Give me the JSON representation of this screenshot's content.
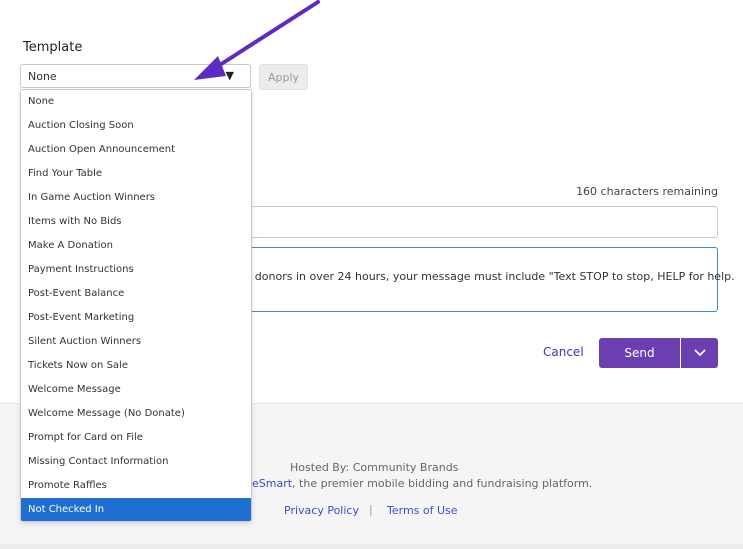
{
  "template": {
    "label": "Template",
    "selected_value": "None",
    "apply_label": "Apply",
    "options": [
      "None",
      "Auction Closing Soon",
      "Auction Open Announcement",
      "Find Your Table",
      "In Game Auction Winners",
      "Items with No Bids",
      "Make A Donation",
      "Payment Instructions",
      "Post-Event Balance",
      "Post-Event Marketing",
      "Silent Auction Winners",
      "Tickets Now on Sale",
      "Welcome Message",
      "Welcome Message (No Donate)",
      "Prompt for Card on File",
      "Missing Contact Information",
      "Promote Raffles",
      "Not Checked In"
    ],
    "highlighted_option": "Not Checked In"
  },
  "message": {
    "chars_remaining": "160 characters remaining",
    "notice": "th donors in over 24 hours, your message must include \"Text STOP to stop, HELP for help."
  },
  "actions": {
    "cancel_label": "Cancel",
    "send_label": "Send"
  },
  "footer": {
    "hosted_by": "Hosted By: Community Brands",
    "platform_link": "eSmart",
    "platform_suffix": ", the premier mobile bidding and fundraising platform.",
    "privacy_label": "Privacy Policy",
    "separator": "|",
    "terms_label": "Terms of Use"
  },
  "colors": {
    "accent": "#6b3fb0",
    "link": "#3a4ec4",
    "selected_option": "#1f6fd0",
    "annotation_arrow": "#5b2bc4"
  },
  "icons": {
    "select_caret": "caret-down-icon",
    "send_menu": "chevron-down-icon",
    "annotation": "arrow-icon"
  }
}
